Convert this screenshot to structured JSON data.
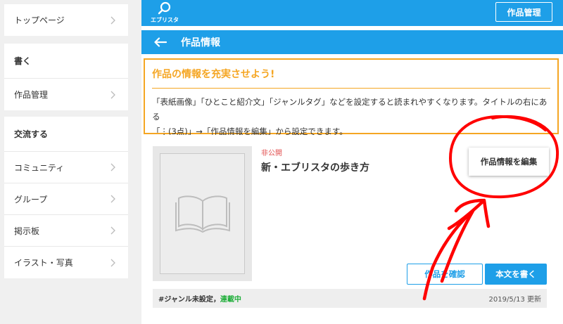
{
  "sidebar": {
    "top_item": "トップページ",
    "write_heading": "書く",
    "write_items": [
      "作品管理"
    ],
    "social_heading": "交流する",
    "social_items": [
      "コミュニティ",
      "グループ",
      "掲示板",
      "イラスト・写真"
    ]
  },
  "topbar": {
    "logo_text": "エブリスタ",
    "manage_button": "作品管理"
  },
  "page": {
    "title": "作品情報"
  },
  "notice": {
    "heading": "作品の情報を充実させよう!",
    "body_line1": "「表紙画像」「ひとこと紹介文」「ジャンルタグ」などを設定すると読まれやすくなります。タイトルの右にある",
    "body_line2": "「⋮(3点)」→「作品情報を編集」から設定できます。"
  },
  "work": {
    "status": "非公開",
    "title": "新・エブリスタの歩き方",
    "edit_button": "作品情報を編集",
    "confirm_button": "作品を確認",
    "write_button": "本文を書く",
    "genre": "#ジャンル未設定",
    "separator": "，",
    "serial_status": "連載中",
    "updated": "2019/5/13 更新"
  },
  "colors": {
    "brand_blue": "#1e9fe8",
    "notice_orange": "#f5a623",
    "annotation_red": "#ff0000",
    "private_red": "#e25050",
    "serial_green": "#1fae3a"
  }
}
